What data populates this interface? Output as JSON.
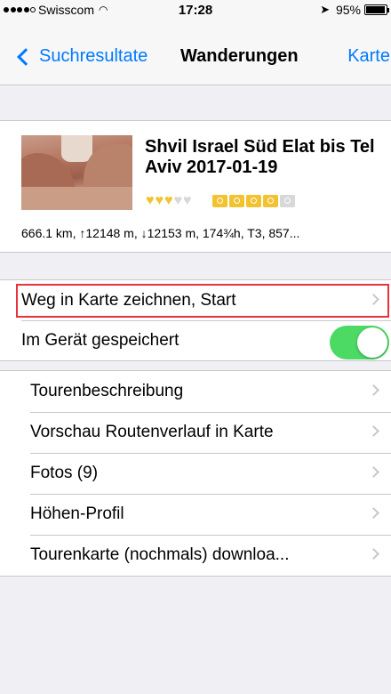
{
  "status_bar": {
    "carrier": "Swisscom",
    "time": "17:28",
    "battery": "95%",
    "battery_level": 0.95
  },
  "nav": {
    "back_label": "Suchresultate",
    "title": "Wanderungen",
    "right_label": "Karte"
  },
  "tour": {
    "title": "Shvil Israel Süd Elat bis Tel Aviv 2017-01-19",
    "heart_rating": 3,
    "heart_max": 5,
    "photo_rating": 4,
    "photo_max": 5,
    "stats": "666.1 km, ↑12148 m, ↓12153 m, 174¾h, T3, 857..."
  },
  "actions": {
    "draw_route": "Weg in Karte zeichnen, Start",
    "saved_label": "Im Gerät gespeichert",
    "saved_on": true
  },
  "menu": [
    {
      "label": "Tourenbeschreibung"
    },
    {
      "label": "Vorschau Routenverlauf in Karte"
    },
    {
      "label": "Fotos (9)"
    },
    {
      "label": "Höhen-Profil"
    },
    {
      "label": "Tourenkarte (nochmals) downloa..."
    }
  ],
  "colors": {
    "accent": "#007aff",
    "toggle_on": "#4cd964",
    "rating": "#f2c230",
    "highlight": "#e8333c"
  }
}
